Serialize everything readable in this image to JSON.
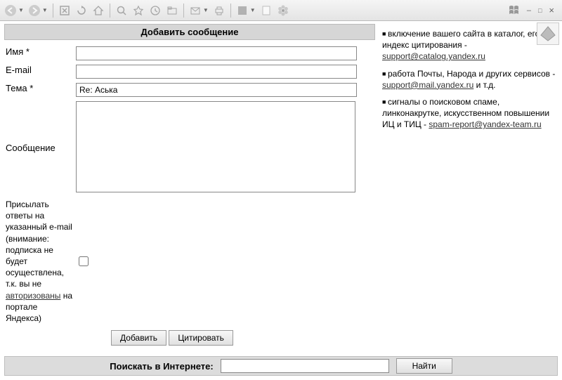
{
  "form": {
    "header": "Добавить сообщение",
    "name_label": "Имя *",
    "name_value": "",
    "email_label": "E-mail",
    "email_value": "",
    "subject_label": "Тема *",
    "subject_value": "Re: Аська",
    "message_label": "Сообщение",
    "message_value": "",
    "subscribe_pre": "Присылать ответы на указанный e-mail",
    "subscribe_note1": "(внимание: подписка не будет осуществлена, т.к. вы не ",
    "subscribe_link": "авторизованы",
    "subscribe_note2": " на портале Яндекса)",
    "add_btn": "Добавить",
    "quote_btn": "Цитировать"
  },
  "side": {
    "item1_pre": "включение вашего сайта в каталог, его индекс цитирования - ",
    "item1_link": "support@catalog.yandex.ru",
    "item2_pre": "работа Почты, Народа и других сервисов - ",
    "item2_link": "support@mail.yandex.ru",
    "item2_post": " и т.д.",
    "item3_pre": "сигналы о поисковом спаме, линконакрутке, искусственном повышении ИЦ и ТИЦ - ",
    "item3_link": "spam-report@yandex-team.ru"
  },
  "search": {
    "label": "Поискать в Интернете:",
    "value": "",
    "button": "Найти"
  },
  "window": {
    "minimize": "–",
    "maximize": "□",
    "close": "×"
  }
}
